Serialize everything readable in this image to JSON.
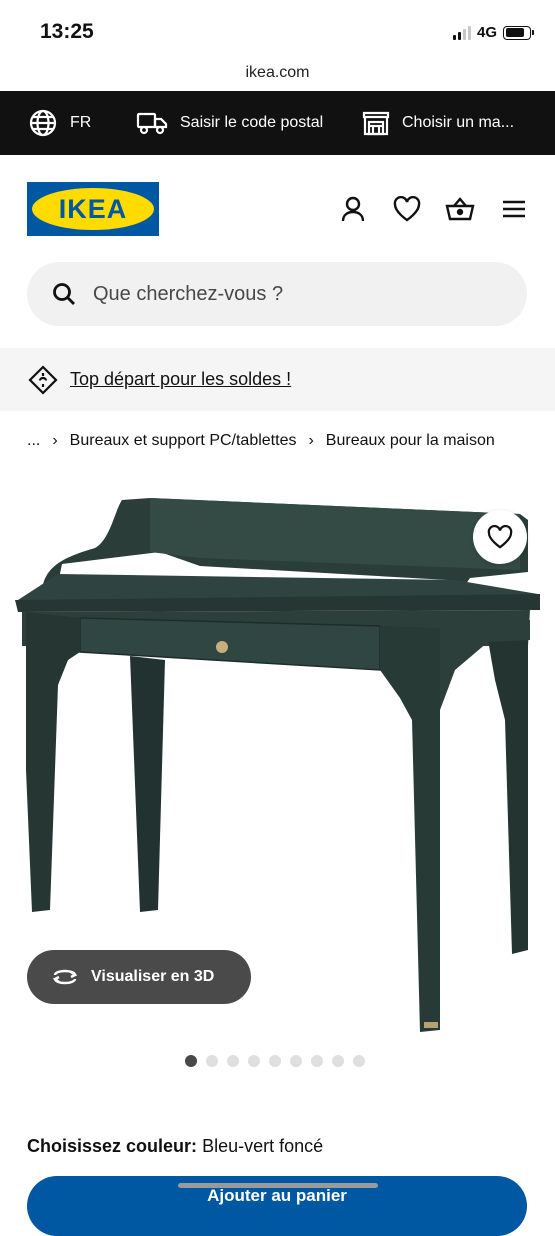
{
  "status": {
    "time": "13:25",
    "network": "4G"
  },
  "browser": {
    "url": "ikea.com"
  },
  "topbar": {
    "language": "FR",
    "postal_code": "Saisir le code postal",
    "store": "Choisir un ma..."
  },
  "header": {
    "logo_text": "IKEA"
  },
  "search": {
    "placeholder": "Que cherchez-vous ?"
  },
  "promo": {
    "text": "Top départ pour les soldes !"
  },
  "breadcrumb": {
    "ellipsis": "...",
    "items": [
      "Bureaux et support PC/tablettes",
      "Bureaux pour la maison"
    ]
  },
  "product": {
    "view_3d_label": "Visualiser en 3D",
    "gallery": {
      "count": 9,
      "active_index": 0
    },
    "color_label": "Choisissez couleur:",
    "color_value": "Bleu-vert foncé",
    "add_to_cart": "Ajouter au panier"
  },
  "colors": {
    "ikea_blue": "#0058a3",
    "ikea_yellow": "#ffdb00",
    "desk_green": "#2c3f3b",
    "topbar_bg": "#111111"
  },
  "icons": [
    "globe-icon",
    "truck-icon",
    "store-icon",
    "user-icon",
    "heart-icon",
    "basket-icon",
    "menu-icon",
    "search-icon",
    "tag-icon",
    "rotate-3d-icon"
  ]
}
